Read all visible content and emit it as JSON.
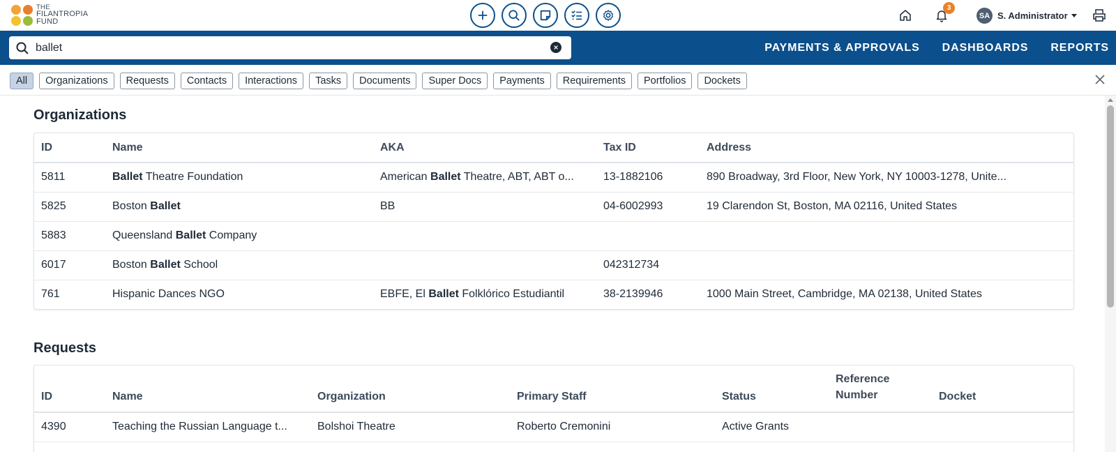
{
  "app": {
    "logo_line1": "THE",
    "logo_line2": "FILANTROPIA",
    "logo_line3": "FUND",
    "logo_colors": [
      "#f2a33a",
      "#e97f2d",
      "#f0c330",
      "#9bbb3c"
    ]
  },
  "top_actions": [
    "add-icon",
    "search-icon",
    "note-icon",
    "task-list-icon",
    "gear-icon"
  ],
  "user": {
    "initials": "SA",
    "name": "S. Administrator",
    "notification_count": "3"
  },
  "search": {
    "value": "ballet",
    "placeholder": "Search"
  },
  "nav": {
    "payments": "PAYMENTS & APPROVALS",
    "dashboards": "DASHBOARDS",
    "reports": "REPORTS"
  },
  "filters": [
    "All",
    "Organizations",
    "Requests",
    "Contacts",
    "Interactions",
    "Tasks",
    "Documents",
    "Super Docs",
    "Payments",
    "Requirements",
    "Portfolios",
    "Dockets"
  ],
  "active_filter": "All",
  "organizations": {
    "title": "Organizations",
    "headers": [
      "ID",
      "Name",
      "AKA",
      "Tax ID",
      "Address"
    ],
    "rows": [
      {
        "id": "5811",
        "name": [
          "",
          "Ballet",
          " Theatre Foundation"
        ],
        "aka": [
          "American ",
          "Ballet",
          " Theatre, ABT, ABT o..."
        ],
        "tax": "13-1882106",
        "address": "890 Broadway, 3rd Floor, New York, NY 10003-1278, Unite..."
      },
      {
        "id": "5825",
        "name": [
          "Boston ",
          "Ballet",
          ""
        ],
        "aka": [
          "BB",
          "",
          ""
        ],
        "tax": "04-6002993",
        "address": "19 Clarendon St, Boston, MA 02116, United States"
      },
      {
        "id": "5883",
        "name": [
          "Queensland ",
          "Ballet",
          " Company"
        ],
        "aka": [
          "",
          "",
          ""
        ],
        "tax": "",
        "address": ""
      },
      {
        "id": "6017",
        "name": [
          "Boston ",
          "Ballet",
          " School"
        ],
        "aka": [
          "",
          "",
          ""
        ],
        "tax": "042312734",
        "address": ""
      },
      {
        "id": "761",
        "name": [
          "Hispanic Dances NGO",
          "",
          ""
        ],
        "aka": [
          "EBFE, El ",
          "Ballet",
          " Folklórico Estudiantil"
        ],
        "tax": "38-2139946",
        "address": "1000 Main Street, Cambridge, MA 02138, United States"
      }
    ]
  },
  "requests": {
    "title": "Requests",
    "headers": [
      "ID",
      "Name",
      "Organization",
      "Primary Staff",
      "Status",
      "Reference Number",
      "Docket"
    ],
    "rows": [
      {
        "id": "4390",
        "name": "Teaching the Russian Language t...",
        "organization": "Bolshoi Theatre",
        "staff": "Roberto Cremonini",
        "status": "Active Grants",
        "reference": "",
        "docket": ""
      }
    ]
  }
}
